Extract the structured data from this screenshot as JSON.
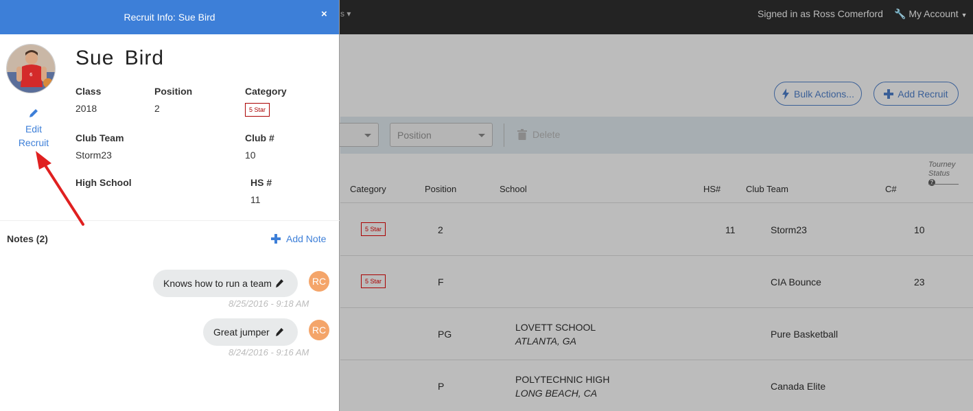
{
  "topbar": {
    "signed_in": "Signed in as Ross Comerford",
    "my_account": "My Account"
  },
  "actions": {
    "bulk": "Bulk Actions...",
    "add_recruit": "Add Recruit"
  },
  "filters": {
    "position_placeholder": "Position",
    "delete": "Delete"
  },
  "table": {
    "headers": {
      "category": "Category",
      "position": "Position",
      "school": "School",
      "hs": "HS#",
      "club_team": "Club Team",
      "c": "C#",
      "tourney_line1": "Tourney",
      "tourney_line2": "Status"
    },
    "rows": [
      {
        "category": "5 Star",
        "position": "2",
        "school": "",
        "location": "",
        "hs": "11",
        "club": "Storm23",
        "c": "10"
      },
      {
        "category": "5 Star",
        "position": "F",
        "school": "",
        "location": "",
        "hs": "",
        "club": "CIA Bounce",
        "c": "23"
      },
      {
        "category": "",
        "position": "PG",
        "school": "LOVETT SCHOOL",
        "location": "ATLANTA, GA",
        "hs": "",
        "club": "Pure Basketball",
        "c": ""
      },
      {
        "category": "",
        "position": "P",
        "school": "POLYTECHNIC HIGH",
        "location": "LONG BEACH, CA",
        "hs": "",
        "club": "Canada Elite",
        "c": ""
      }
    ]
  },
  "panel": {
    "title": "Recruit Info: Sue Bird",
    "close": "×",
    "name": "Sue  Bird",
    "edit_line1": "Edit",
    "edit_line2": "Recruit",
    "class_label": "Class",
    "class_value": "2018",
    "position_label": "Position",
    "position_value": "2",
    "category_label": "Category",
    "category_value": "5 Star",
    "club_team_label": "Club Team",
    "club_team_value": "Storm23",
    "club_num_label": "Club #",
    "club_num_value": "10",
    "high_school_label": "High School",
    "hs_num_label": "HS #",
    "hs_num_value": "11",
    "notes_label": "Notes (2)",
    "add_note": "Add Note",
    "notes": [
      {
        "text": "Knows how to run a team",
        "initials": "RC",
        "time": "8/25/2016 - 9:18 AM"
      },
      {
        "text": "Great jumper",
        "initials": "RC",
        "time": "8/24/2016 - 9:16 AM"
      }
    ]
  },
  "colors": {
    "accent": "#3d7fd8",
    "badge": "#aa0000",
    "avatar_initials_bg": "#f4a56a",
    "annotation_arrow": "#e02020"
  }
}
